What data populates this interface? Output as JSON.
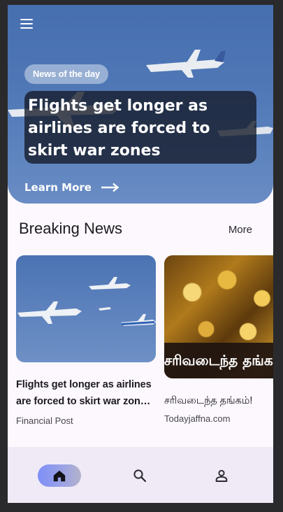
{
  "hero": {
    "chip": "News of the day",
    "title": "Flights get longer as airlines are forced to skirt war zones",
    "cta": "Learn More",
    "icons": [
      "menu-icon",
      "arrow-right-icon"
    ]
  },
  "section": {
    "title": "Breaking News",
    "more": "More"
  },
  "cards": [
    {
      "headline": "Flights get longer as airlines are forced to skirt war zon…",
      "source": "Financial Post"
    },
    {
      "image_caption": "சரிவடைந்த தங்கம்",
      "headline": "சரிவடைந்த தங்கம்!",
      "source": "Todayjaffna.com"
    }
  ],
  "bottom_nav": {
    "items": [
      "home-icon",
      "search-icon",
      "person-icon"
    ],
    "selected": "home-icon"
  },
  "colors": {
    "hero_sky": "#4f77b6",
    "page_bg": "#fcf8fd",
    "nav_bg": "#efeaf6",
    "nav_active": "#8e97ee"
  }
}
